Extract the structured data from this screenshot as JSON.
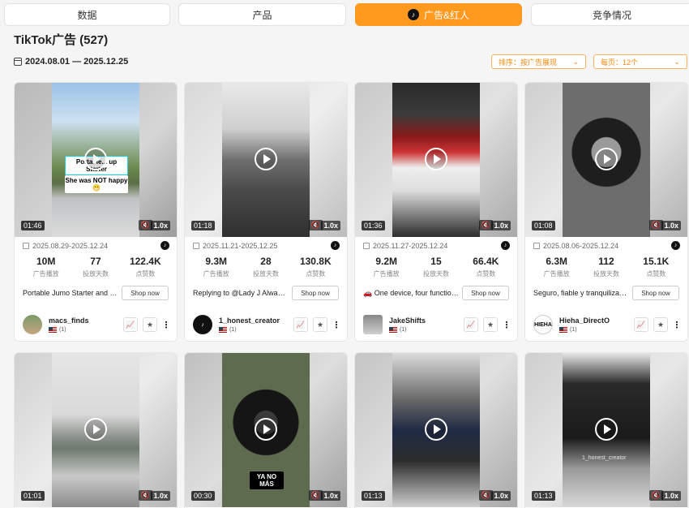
{
  "tabs": [
    {
      "label": "数据",
      "active": false
    },
    {
      "label": "产品",
      "active": false
    },
    {
      "label": "广告&红人",
      "active": true,
      "icon": "tiktok-icon"
    },
    {
      "label": "竞争情况",
      "active": false
    }
  ],
  "header": {
    "title": "TikTok广告 (527)",
    "date_range": "2024.08.01 — 2025.12.25"
  },
  "controls": {
    "sort_label": "排序：按广告展现",
    "per_page_label": "每页：12个"
  },
  "labels": {
    "plays": "广告播放",
    "days": "投放天数",
    "likes": "点赞数",
    "shop_now": "Shop now",
    "speed": "1.0x",
    "mute_icon": "🔇"
  },
  "colors": {
    "accent": "#ff9a1f"
  },
  "ads": [
    {
      "duration": "01:46",
      "dates": "2025.08.29-2025.12.24",
      "plays": "10M",
      "days": "77",
      "likes": "122.4K",
      "description": "Portable Jumo Starter and Tire ...",
      "creator": "macs_finds",
      "count": "(1)",
      "overlay1": "Portal le... up Starter",
      "overlay2": "She was NOT happy 😬"
    },
    {
      "duration": "01:18",
      "dates": "2025.11.21-2025.12.25",
      "plays": "9.3M",
      "days": "28",
      "likes": "130.8K",
      "description": "Replying to @Lady J Always be...",
      "creator": "1_honest_creator",
      "count": "(1)"
    },
    {
      "duration": "01:36",
      "dates": "2025.11.27-2025.12.24",
      "plays": "9.2M",
      "days": "15",
      "likes": "66.4K",
      "description": "🚗 One device, four functions! ...",
      "creator": "JakeShifts",
      "count": "(1)"
    },
    {
      "duration": "01:08",
      "dates": "2025.08.06-2025.12.24",
      "plays": "6.3M",
      "days": "112",
      "likes": "15.1K",
      "description": "Seguro, fiable y tranquilizador. ...",
      "creator": "Hieha_DirectO",
      "count": "(1)",
      "avatar_text": "HIEHA"
    },
    {
      "duration": "01:01"
    },
    {
      "duration": "00:30",
      "overlay1": "YA NO MÁS"
    },
    {
      "duration": "01:13"
    },
    {
      "duration": "01:13",
      "watermark": "1_honest_creator"
    }
  ]
}
